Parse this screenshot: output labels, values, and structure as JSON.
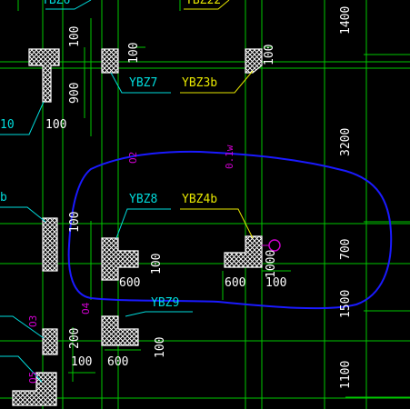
{
  "colors": {
    "background": "#000000",
    "grid": "#00c800",
    "wall": "#ffffff",
    "dim": "#ffffff",
    "leader_cyan": "#00dcdc",
    "leader_yellow": "#e6e600",
    "magenta": "#d000d0",
    "annotation_cloud": "#1a1aff"
  },
  "tags": {
    "ybz6": "YBZ6",
    "ybz22": "YBZ22",
    "ybz7": "YBZ7",
    "ybz3b": "YBZ3b",
    "ybz8": "YBZ8",
    "ybz4b": "YBZ4b",
    "ybz9": "YBZ9",
    "tag_left_10": "10",
    "tag_left_b": "b"
  },
  "dimensions": {
    "d100_top_a": "100",
    "d100_top_b": "100",
    "d100_top_c": "100",
    "d900": "900",
    "d100_mid": "100",
    "d1400": "1400",
    "d3200": "3200",
    "d700": "700",
    "d1500": "1500",
    "d1100": "1100",
    "d100_ybz8_v": "100",
    "d600_ybz8": "600",
    "d100_ybz8_h": "100",
    "d600_ybz4b": "600",
    "d100_ybz4b": "100",
    "d1000_ybz4b": "1000",
    "d200": "200",
    "d100_bot_a": "100",
    "d600_bot": "600",
    "d100_bot_v": "100"
  },
  "axis_marks": {
    "o2": "O2",
    "o1w": "0.1w",
    "o3": "O3",
    "o4": "O4",
    "o5": "O5"
  }
}
